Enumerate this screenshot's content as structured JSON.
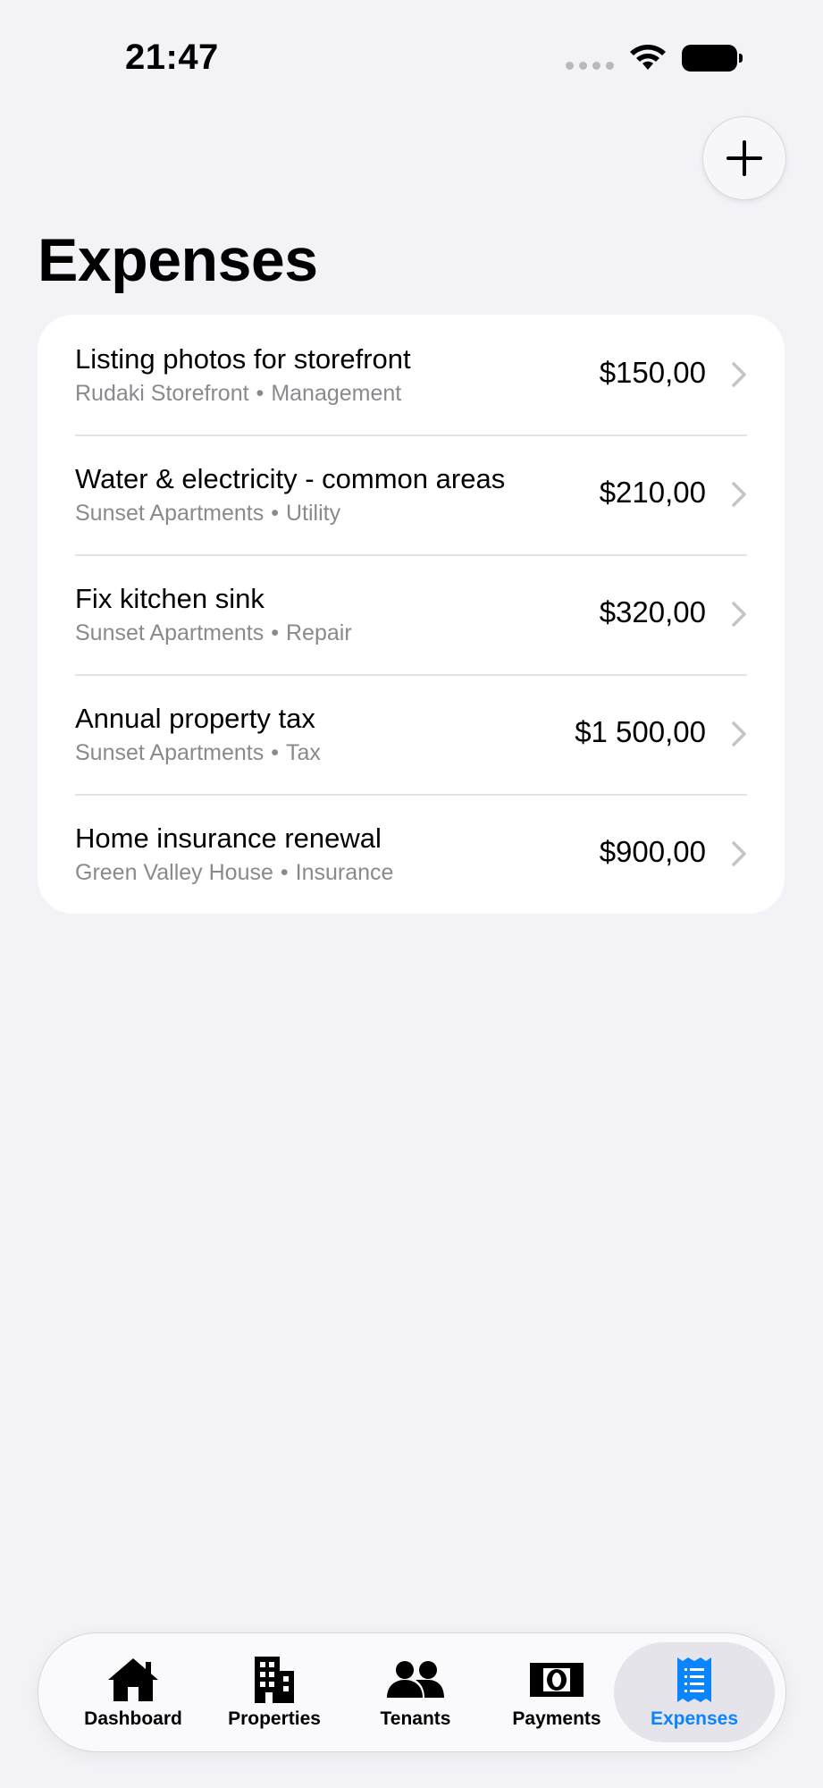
{
  "status_bar": {
    "time": "21:47"
  },
  "header": {
    "title": "Expenses",
    "add_icon": "plus-icon"
  },
  "expenses": [
    {
      "title": "Listing photos for storefront",
      "property": "Rudaki Storefront",
      "category": "Management",
      "amount": "$150,00"
    },
    {
      "title": "Water & electricity - common areas",
      "property": "Sunset Apartments",
      "category": "Utility",
      "amount": "$210,00"
    },
    {
      "title": "Fix kitchen sink",
      "property": "Sunset Apartments",
      "category": "Repair",
      "amount": "$320,00"
    },
    {
      "title": "Annual property tax",
      "property": "Sunset Apartments",
      "category": "Tax",
      "amount": "$1 500,00"
    },
    {
      "title": "Home insurance renewal",
      "property": "Green Valley House",
      "category": "Insurance",
      "amount": "$900,00"
    }
  ],
  "separator": "•",
  "tab_bar": {
    "tabs": [
      {
        "label": "Dashboard",
        "icon": "house-icon"
      },
      {
        "label": "Properties",
        "icon": "building-icon"
      },
      {
        "label": "Tenants",
        "icon": "people-icon"
      },
      {
        "label": "Payments",
        "icon": "banknote-icon"
      },
      {
        "label": "Expenses",
        "icon": "receipt-icon"
      }
    ],
    "active": "Expenses"
  },
  "colors": {
    "background": "#f2f2f7",
    "card": "#ffffff",
    "accent": "#0a84ff",
    "secondary_text": "#8a8a8e"
  }
}
